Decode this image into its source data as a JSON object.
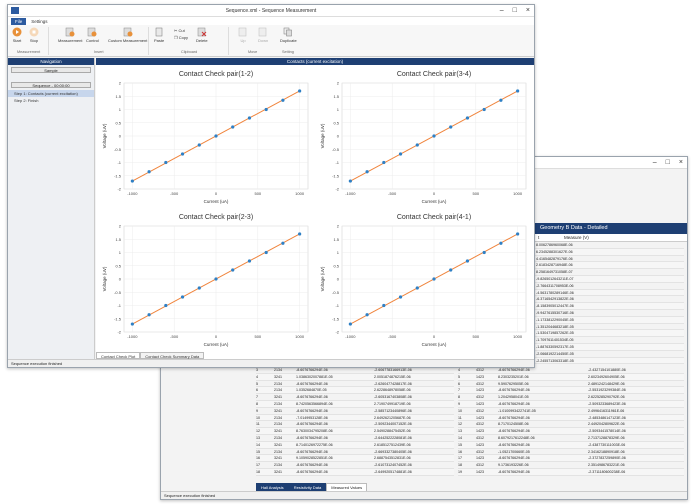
{
  "front": {
    "title": "Sequence.xml - Sequence Measurement",
    "tabs": [
      "File",
      "Settings"
    ],
    "ribbon_buttons": [
      "Start",
      "Stop",
      "Measurement",
      "Control",
      "Custom Measurement",
      "Paste",
      "Cut",
      "Copy",
      "Delete",
      "Up",
      "Down",
      "Duplicate"
    ],
    "ribbon_groups": [
      "Measurement",
      "Insert",
      "Clipboard",
      "Move",
      "Setting"
    ],
    "nav": {
      "header": "Navigation",
      "combo": "Sample",
      "sequence": "Sequence - 00:00:00",
      "steps": [
        "Step 1: Contacts (current excitation)",
        "Step 2: Finish"
      ]
    },
    "main_header": "Contacts (current excitation)",
    "bottom_tabs": [
      "Contact Check Plot",
      "Contact Check Summary Data"
    ],
    "status": "Sequence execution finished"
  },
  "back": {
    "table_header": "Geometry B Data - Detailed",
    "col_header": "Measure (V)",
    "right_values": [
      "8.0062786960068E-06",
      "6.2345288301627E-06",
      "4.4165482879176E-06",
      "2.6183428716948E-06",
      "8.2581649731058E-07",
      "-9.8265012643211E-07",
      "-2.7664311708953E-06",
      "-4.5631780289146E-06",
      "-6.3716542913822E-06",
      "-8.1583905012447E-06",
      "-9.9427615530716E-06",
      "-1.1733812290045E-05",
      "-1.3512044683218E-05",
      "-1.5304719857262E-05",
      "-1.7097611401534E-05",
      "-1.8876330592317E-05",
      "-2.0668192214450E-05",
      "-2.2455713063318E-05",
      "-2.4245019983217E-05",
      "-2.6026710924012E-05",
      "-2.7815391204633E-05",
      "-2.9608816603177E-05",
      "-3.1392475590841E-05",
      "-3.3180713628201E-05",
      "-3.4967224515036E-05",
      "-3.6760188201952E-05",
      "-3.8542317705312E-05",
      "-4.0331895003871E-05",
      "-4.2117563300514E-05",
      "-4.3907221903625E-05",
      "-4.5694837715068E-05",
      "-4.7481059031257E-05"
    ],
    "left_rows": [
      [
        "3",
        "2134",
        "-8.6076766294E-06",
        "-2.6067783166913E-06"
      ],
      [
        "4",
        "3241",
        "1.0386302007881E-05",
        "2.0051874876215E-06"
      ],
      [
        "5",
        "2134",
        "-8.6076766294E-06",
        "-2.6260477428817E-06"
      ],
      [
        "6",
        "2134",
        "1.0352684870E-05",
        "2.6228648978058E-06"
      ],
      [
        "7",
        "3241",
        "-8.6076766294E-06",
        "-2.6053167403808E-06"
      ],
      [
        "8",
        "2134",
        "8.7420563566894E-06",
        "2.7190749918719E-06"
      ],
      [
        "9",
        "3241",
        "-8.6076766294E-06",
        "-2.5857123440896E-06"
      ],
      [
        "10",
        "2134",
        "-7.0149953128E-06",
        "2.6492621205687E-06"
      ],
      [
        "11",
        "2134",
        "-8.6076766294E-06",
        "-2.5092344007152E-06"
      ],
      [
        "12",
        "3241",
        "8.7630034795208E-06",
        "2.5490288475452E-06"
      ],
      [
        "13",
        "2134",
        "-8.6076766294E-06",
        "-2.6442522228081E-06"
      ],
      [
        "14",
        "3241",
        "8.7140126972275E-06",
        "2.6185127512439E-06"
      ],
      [
        "15",
        "2134",
        "-8.6076766294E-06",
        "-2.6693327380405E-06"
      ],
      [
        "16",
        "3241",
        "9.1059028522851E-06",
        "2.6887543512831E-06"
      ],
      [
        "17",
        "2134",
        "-8.6076766294E-06",
        "-2.6107312407452E-06"
      ],
      [
        "18",
        "3241",
        "-8.6076766294E-06",
        "-2.6499205174881E-06"
      ]
    ],
    "mid_rows": [
      [
        "4",
        "4312",
        "-8.6076766294E-06",
        "-2.4327154101880E-06"
      ],
      [
        "5",
        "1423",
        "8.2303235201E-06",
        "2.6023492604905E-06"
      ],
      [
        "6",
        "4312",
        "9.5907629505E-06",
        "2.4891242148429E-06"
      ],
      [
        "7",
        "1423",
        "-8.6076766294E-06",
        "-2.5531923299384E-06"
      ],
      [
        "8",
        "4312",
        "1.2042958041E-05",
        "2.6225285290792E-06"
      ],
      [
        "9",
        "1423",
        "-8.6076766294E-06",
        "-2.5093233689423E-06"
      ],
      [
        "10",
        "4312",
        "-1.0100993422741E-05",
        "2.4996416311961E-06"
      ],
      [
        "11",
        "1423",
        "-8.6076766294E-06",
        "-2.4853486147123E-06"
      ],
      [
        "12",
        "4312",
        "8.7170124508E-06",
        "2.4492042809622E-06"
      ],
      [
        "13",
        "1423",
        "-8.6076766294E-06",
        "-2.5093441578014E-06"
      ],
      [
        "14",
        "4312",
        "8.6079217612248E-06",
        "2.7137128878329E-06"
      ],
      [
        "15",
        "1423",
        "-8.6076766294E-06",
        "-2.4387730111003E-06"
      ],
      [
        "16",
        "4312",
        "-1.0521700660E-05",
        "2.3416218890918E-06"
      ],
      [
        "17",
        "1423",
        "-8.6076766294E-06",
        "-2.3727837259890E-06"
      ],
      [
        "18",
        "4312",
        "9.1736193226E-06",
        "2.3514986783221E-06"
      ],
      [
        "19",
        "1423",
        "-8.6076766294E-06",
        "-2.3711180600238E-06"
      ]
    ],
    "bottom_tabs": [
      "Hall Analysis",
      "Resistivity Data",
      "Measured Values"
    ],
    "status": "Sequence execution finished"
  },
  "charts": [
    {
      "title": "Contact Check pair(1-2)",
      "xlabel": "Current (uA)",
      "ylabel": "Voltage (uV)"
    },
    {
      "title": "Contact Check pair(3-4)",
      "xlabel": "Current (uA)",
      "ylabel": "Voltage (uV)"
    },
    {
      "title": "Contact Check pair(2-3)",
      "xlabel": "Current (uA)",
      "ylabel": "Voltage (uV)"
    },
    {
      "title": "Contact Check pair(4-1)",
      "xlabel": "Current (uA)",
      "ylabel": "Voltage (uV)"
    }
  ],
  "chart_data": [
    {
      "type": "scatter",
      "title": "Contact Check pair(1-2)",
      "xlabel": "Current (uA)",
      "ylabel": "Voltage (uV)",
      "x": [
        -1000,
        -800,
        -600,
        -400,
        -200,
        0,
        200,
        400,
        600,
        800,
        1000
      ],
      "y": [
        -1.7,
        -1.35,
        -1.0,
        -0.68,
        -0.34,
        0,
        0.34,
        0.68,
        1.0,
        1.35,
        1.7
      ],
      "xlim": [
        -1100,
        1100
      ],
      "ylim": [
        -2,
        2
      ],
      "colors": {
        "line": "#f0843c",
        "marker": "#2f80c5"
      }
    },
    {
      "type": "scatter",
      "title": "Contact Check pair(3-4)",
      "xlabel": "Current (uA)",
      "ylabel": "Voltage (uV)",
      "x": [
        -1000,
        -800,
        -600,
        -400,
        -200,
        0,
        200,
        400,
        600,
        800,
        1000
      ],
      "y": [
        -1.7,
        -1.35,
        -1.0,
        -0.68,
        -0.34,
        0,
        0.34,
        0.68,
        1.0,
        1.35,
        1.7
      ],
      "xlim": [
        -1100,
        1100
      ],
      "ylim": [
        -2,
        2
      ],
      "colors": {
        "line": "#f0843c",
        "marker": "#2f80c5"
      }
    },
    {
      "type": "scatter",
      "title": "Contact Check pair(2-3)",
      "xlabel": "Current (uA)",
      "ylabel": "Voltage (uV)",
      "x": [
        -1000,
        -800,
        -600,
        -400,
        -200,
        0,
        200,
        400,
        600,
        800,
        1000
      ],
      "y": [
        -1.7,
        -1.35,
        -1.0,
        -0.68,
        -0.34,
        0,
        0.34,
        0.68,
        1.0,
        1.35,
        1.7
      ],
      "xlim": [
        -1100,
        1100
      ],
      "ylim": [
        -2,
        2
      ],
      "colors": {
        "line": "#f0843c",
        "marker": "#2f80c5"
      }
    },
    {
      "type": "scatter",
      "title": "Contact Check pair(4-1)",
      "xlabel": "Current (uA)",
      "ylabel": "Voltage (uV)",
      "x": [
        -1000,
        -800,
        -600,
        -400,
        -200,
        0,
        200,
        400,
        600,
        800,
        1000
      ],
      "y": [
        -1.7,
        -1.35,
        -1.0,
        -0.68,
        -0.34,
        0,
        0.34,
        0.68,
        1.0,
        1.35,
        1.7
      ],
      "xlim": [
        -1100,
        1100
      ],
      "ylim": [
        -2,
        2
      ],
      "colors": {
        "line": "#f0843c",
        "marker": "#2f80c5"
      }
    }
  ],
  "axis_ticks": {
    "x": [
      "-1000",
      "-500",
      "0",
      "500",
      "1000"
    ],
    "y": [
      "2",
      "1.5",
      "1",
      "0.5",
      "0",
      "-0.5",
      "-1",
      "-1.5",
      "-2"
    ]
  },
  "colors": {
    "accent": "#1e3f73",
    "tab": "#2d5ba0"
  }
}
